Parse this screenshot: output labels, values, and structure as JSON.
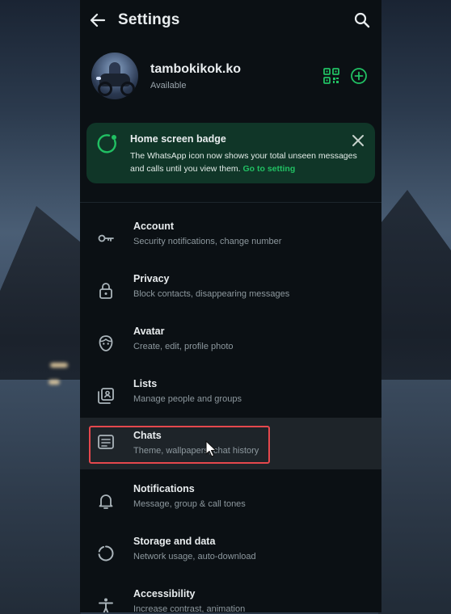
{
  "header": {
    "title": "Settings",
    "back_icon": "arrow-left-icon",
    "search_icon": "search-icon"
  },
  "profile": {
    "name": "tambokikok.ko",
    "status": "Available"
  },
  "badge": {
    "title": "Home screen badge",
    "text": "The WhatsApp icon now shows your total unseen messages and calls until you view them.",
    "link": "Go to setting",
    "accent": "#21c063"
  },
  "settings": {
    "items": [
      {
        "title": "Account",
        "subtitle": "Security notifications, change number",
        "icon": "key-icon"
      },
      {
        "title": "Privacy",
        "subtitle": "Block contacts, disappearing messages",
        "icon": "lock-icon"
      },
      {
        "title": "Avatar",
        "subtitle": "Create, edit, profile photo",
        "icon": "avatar-face-icon"
      },
      {
        "title": "Lists",
        "subtitle": "Manage people and groups",
        "icon": "lists-icon"
      },
      {
        "title": "Chats",
        "subtitle": "Theme, wallpapers, chat history",
        "icon": "chat-icon"
      },
      {
        "title": "Notifications",
        "subtitle": "Message, group & call tones",
        "icon": "bell-icon"
      },
      {
        "title": "Storage and data",
        "subtitle": "Network usage, auto-download",
        "icon": "storage-circle-icon"
      },
      {
        "title": "Accessibility",
        "subtitle": "Increase contrast, animation",
        "icon": "accessibility-icon"
      }
    ]
  },
  "colors": {
    "panel": "#0b1014",
    "accent": "#21c063",
    "highlight": "#e5484d"
  }
}
